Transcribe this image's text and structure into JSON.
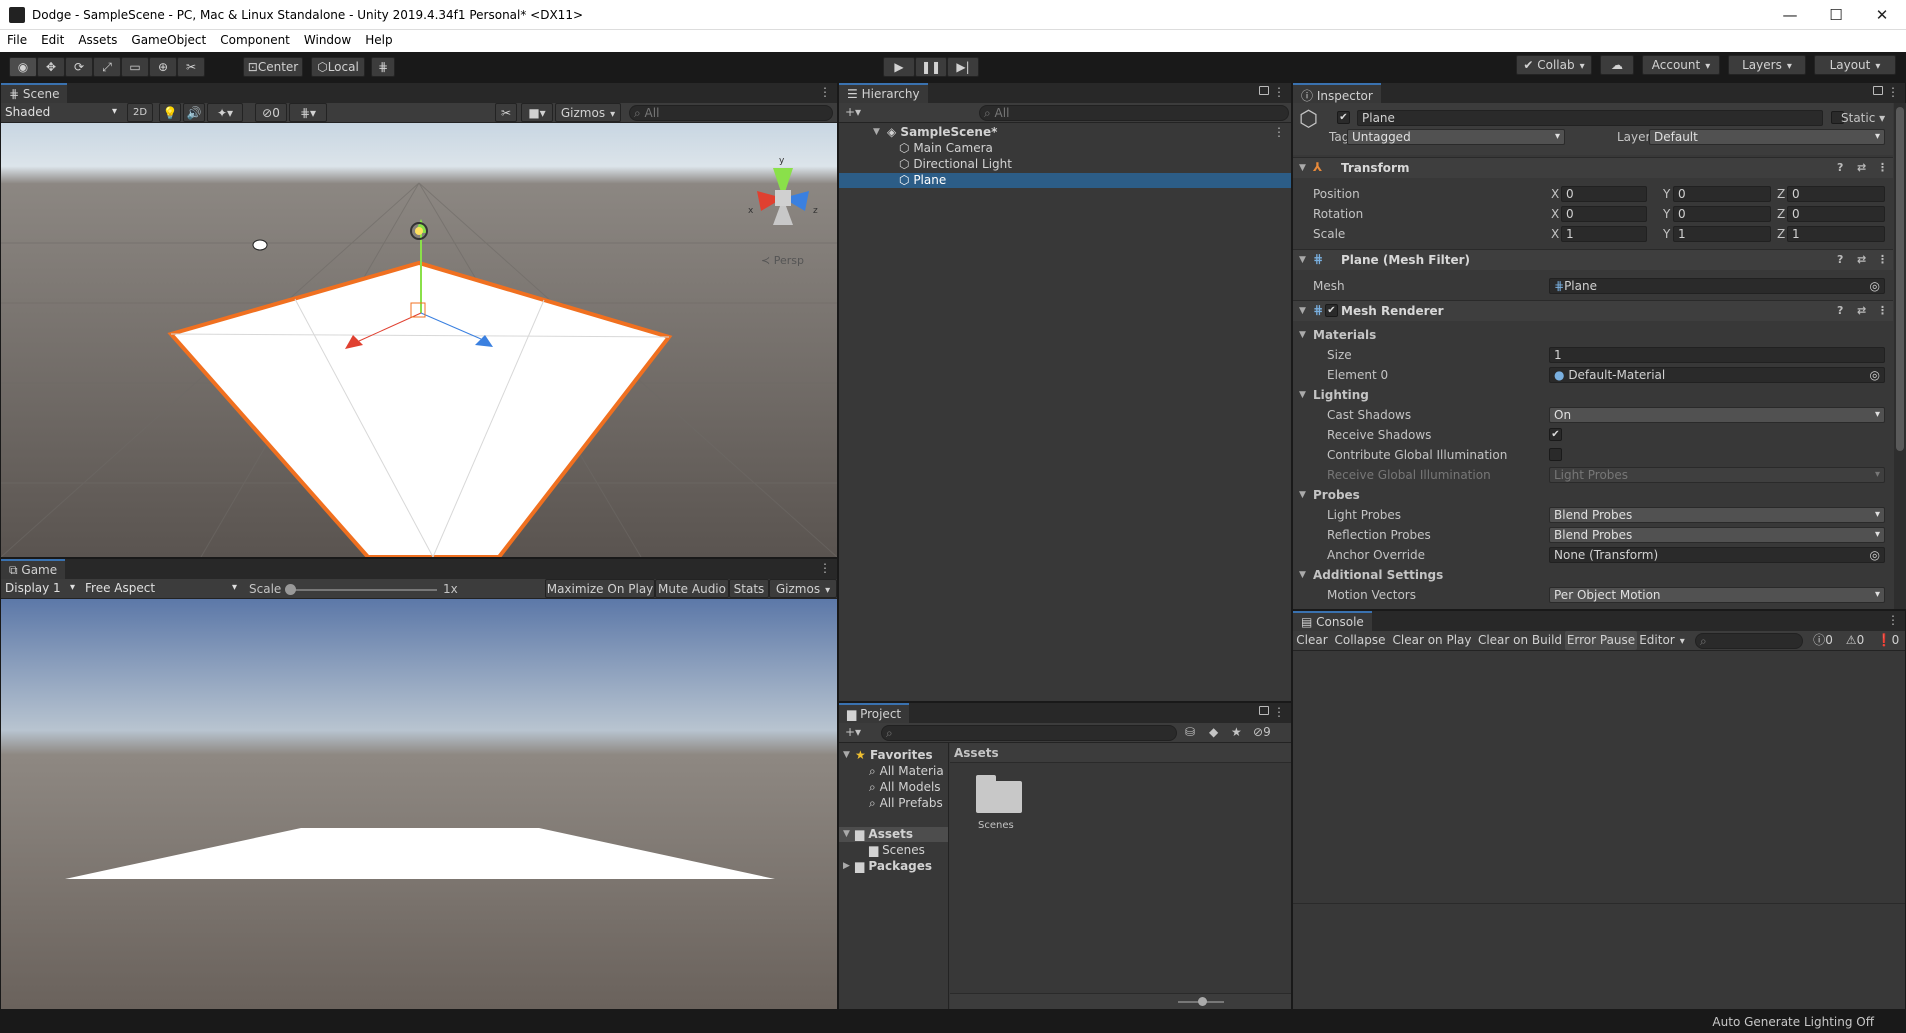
{
  "window": {
    "title": "Dodge - SampleScene - PC, Mac & Linux Standalone - Unity 2019.4.34f1 Personal* <DX11>",
    "minimize": "—",
    "maximize": "☐",
    "close": "✕"
  },
  "menu": [
    "File",
    "Edit",
    "Assets",
    "GameObject",
    "Component",
    "Window",
    "Help"
  ],
  "toolbar": {
    "pivot": "Center",
    "space": "Local",
    "collab": "Collab",
    "account": "Account",
    "layers": "Layers",
    "layout": "Layout"
  },
  "scene": {
    "tab": "Scene",
    "shading": "Shaded",
    "mode2d": "2D",
    "hidden_count": "0",
    "gizmos": "Gizmos",
    "search_placeholder": "All",
    "persp": "Persp",
    "axes": {
      "x": "x",
      "y": "y",
      "z": "z"
    }
  },
  "game": {
    "tab": "Game",
    "display": "Display 1",
    "aspect": "Free Aspect",
    "scale_label": "Scale",
    "scale_value": "1x",
    "maximize": "Maximize On Play",
    "mute": "Mute Audio",
    "stats": "Stats",
    "gizmos": "Gizmos"
  },
  "hierarchy": {
    "tab": "Hierarchy",
    "search_placeholder": "All",
    "scene": "SampleScene*",
    "items": [
      "Main Camera",
      "Directional Light",
      "Plane"
    ]
  },
  "project": {
    "tab": "Project",
    "hidden_count": "9",
    "favorites": "Favorites",
    "fav_items": [
      "All Materia",
      "All Models",
      "All Prefabs"
    ],
    "assets": "Assets",
    "asset_children": [
      "Scenes"
    ],
    "packages": "Packages",
    "breadcrumb": "Assets",
    "folder": "Scenes"
  },
  "inspector": {
    "tab": "Inspector",
    "object_name": "Plane",
    "static": "Static",
    "tag_label": "Tag",
    "tag": "Untagged",
    "layer_label": "Layer",
    "layer": "Default",
    "transform": {
      "title": "Transform",
      "rows": [
        {
          "label": "Position",
          "x": "0",
          "y": "0",
          "z": "0"
        },
        {
          "label": "Rotation",
          "x": "0",
          "y": "0",
          "z": "0"
        },
        {
          "label": "Scale",
          "x": "1",
          "y": "1",
          "z": "1"
        }
      ]
    },
    "mesh_filter": {
      "title": "Plane (Mesh Filter)",
      "mesh_label": "Mesh",
      "mesh": "Plane"
    },
    "mesh_renderer": {
      "title": "Mesh Renderer",
      "materials": "Materials",
      "size_label": "Size",
      "size": "1",
      "element0_label": "Element 0",
      "element0": "Default-Material",
      "lighting": "Lighting",
      "cast_shadows_label": "Cast Shadows",
      "cast_shadows": "On",
      "receive_shadows_label": "Receive Shadows",
      "contribute_gi_label": "Contribute Global Illumination",
      "receive_gi_label": "Receive Global Illumination",
      "receive_gi": "Light Probes",
      "probes": "Probes",
      "light_probes_label": "Light Probes",
      "light_probes": "Blend Probes",
      "reflection_probes_label": "Reflection Probes",
      "reflection_probes": "Blend Probes",
      "anchor_label": "Anchor Override",
      "anchor": "None (Transform)",
      "additional": "Additional Settings",
      "motion_label": "Motion Vectors",
      "motion": "Per Object Motion"
    }
  },
  "console": {
    "tab": "Console",
    "clear": "Clear",
    "collapse": "Collapse",
    "clear_on_play": "Clear on Play",
    "clear_on_build": "Clear on Build",
    "error_pause": "Error Pause",
    "editor": "Editor",
    "info_count": "0",
    "warn_count": "0",
    "error_count": "0"
  },
  "status": {
    "lighting": "Auto Generate Lighting Off"
  }
}
